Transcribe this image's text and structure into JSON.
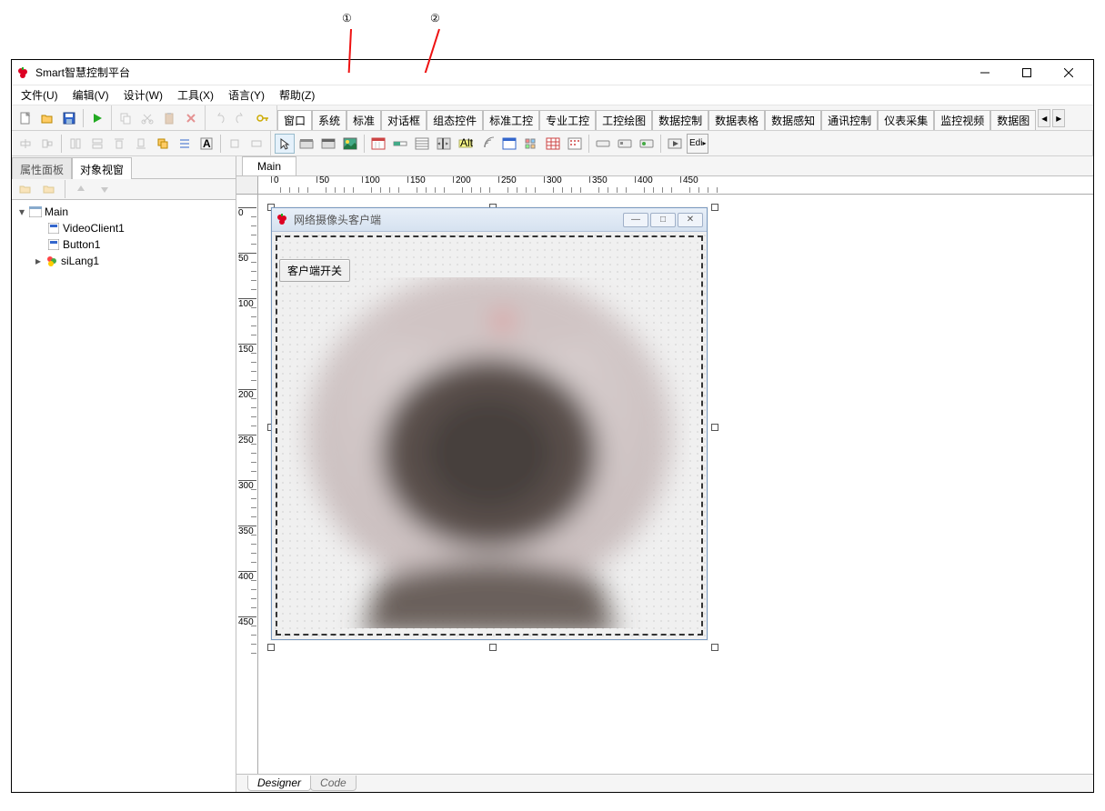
{
  "callouts": {
    "one": "①",
    "two": "②"
  },
  "window": {
    "title": "Smart智慧控制平台"
  },
  "menubar": [
    "文件(U)",
    "编辑(V)",
    "设计(W)",
    "工具(X)",
    "语言(Y)",
    "帮助(Z)"
  ],
  "category_tabs": [
    "窗口",
    "系统",
    "标准",
    "对话框",
    "组态控件",
    "标准工控",
    "专业工控",
    "工控绘图",
    "数据控制",
    "数据表格",
    "数据感知",
    "通讯控制",
    "仪表采集",
    "监控视频",
    "数据图"
  ],
  "left_panel": {
    "tabs": {
      "inactive": "属性面板",
      "active": "对象视窗"
    },
    "tree": {
      "root": "Main",
      "children": [
        "VideoClient1",
        "Button1",
        "siLang1"
      ]
    }
  },
  "doc_tab": "Main",
  "ruler_h": [
    "0",
    "50",
    "100",
    "150",
    "200",
    "250",
    "300",
    "350",
    "400",
    "450"
  ],
  "ruler_v": [
    "0",
    "50",
    "100",
    "150",
    "200",
    "250",
    "300",
    "350",
    "400",
    "450"
  ],
  "form": {
    "title": "网络摄像头客户端",
    "button_label": "客户端开关"
  },
  "bottom_tabs": {
    "active": "Designer",
    "inactive": "Code"
  },
  "edit_btn": "Edi"
}
